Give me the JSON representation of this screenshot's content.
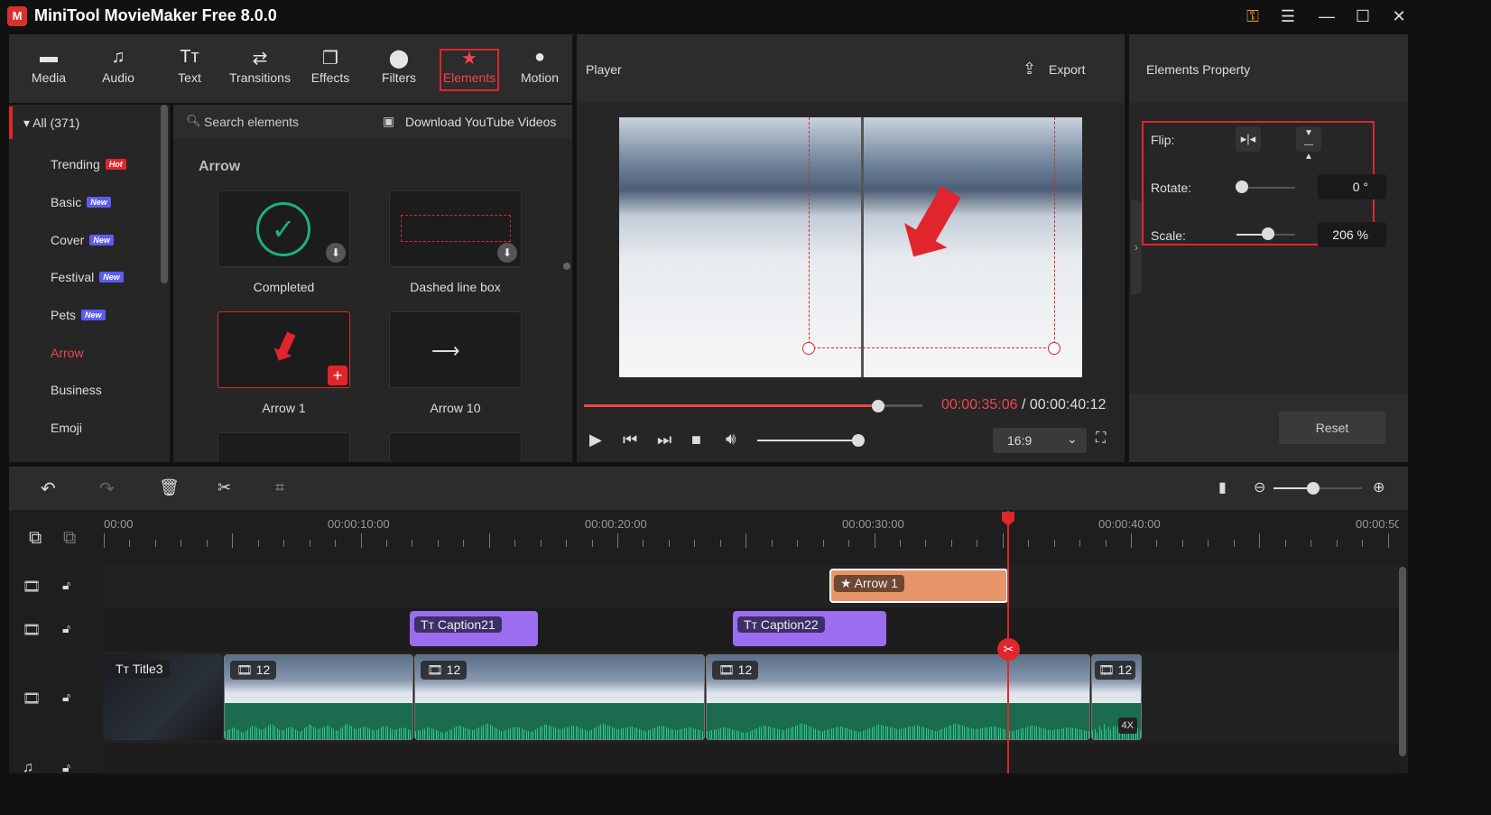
{
  "app": {
    "title": "MiniTool MovieMaker Free 8.0.0",
    "logo_text": "MiniTool"
  },
  "colors": {
    "accent": "#f0454a",
    "caption_clip": "#9b6ef0",
    "element_clip": "#e8956a",
    "audio_wave": "#2fd38f"
  },
  "toolbar": {
    "items": [
      {
        "label": "Media",
        "icon": "folder-icon"
      },
      {
        "label": "Audio",
        "icon": "music-note-icon"
      },
      {
        "label": "Text",
        "icon": "text-icon"
      },
      {
        "label": "Transitions",
        "icon": "transition-arrows-icon"
      },
      {
        "label": "Effects",
        "icon": "effects-icon"
      },
      {
        "label": "Filters",
        "icon": "filters-icon"
      },
      {
        "label": "Elements",
        "icon": "elements-star-icon",
        "active": true
      },
      {
        "label": "Motion",
        "icon": "motion-icon"
      }
    ]
  },
  "sidebar": {
    "all": "All (371)",
    "items": [
      {
        "label": "Trending",
        "badge": "Hot"
      },
      {
        "label": "Basic",
        "badge": "New"
      },
      {
        "label": "Cover",
        "badge": "New"
      },
      {
        "label": "Festival",
        "badge": "New"
      },
      {
        "label": "Pets",
        "badge": "New"
      },
      {
        "label": "Arrow",
        "active": true
      },
      {
        "label": "Business"
      },
      {
        "label": "Emoji"
      }
    ]
  },
  "elements": {
    "search_placeholder": "Search elements",
    "download_youtube": "Download YouTube Videos",
    "section": "Arrow",
    "cards": [
      {
        "label": "Completed"
      },
      {
        "label": "Dashed line box"
      },
      {
        "label": "Arrow 1",
        "selected": true
      },
      {
        "label": "Arrow 10"
      }
    ]
  },
  "player": {
    "title": "Player",
    "export": "Export",
    "current_time": "00:00:35:06",
    "separator": " / ",
    "total_time": "00:00:40:12",
    "progress": 0.87,
    "volume": 1.0,
    "aspect": "16:9"
  },
  "property": {
    "title": "Elements Property",
    "flip_label": "Flip:",
    "rotate_label": "Rotate:",
    "rotate_value": "0 °",
    "rotate": 0,
    "scale_label": "Scale:",
    "scale_value": "206 %",
    "scale": 206,
    "reset": "Reset"
  },
  "timeline": {
    "ruler": [
      "00:00",
      "00:00:10:00",
      "00:00:20:00",
      "00:00:30:00",
      "00:00:40:00",
      "00:00:50"
    ],
    "playhead": "00:00:35:06",
    "track1": [
      {
        "label": "Arrow 1"
      }
    ],
    "track2": [
      {
        "label": "Caption21"
      },
      {
        "label": "Caption22"
      }
    ],
    "main": [
      {
        "label": "Title3"
      },
      {
        "label": "12"
      },
      {
        "label": "12"
      },
      {
        "label": "12"
      },
      {
        "label": "12",
        "speed": "4X"
      }
    ]
  }
}
